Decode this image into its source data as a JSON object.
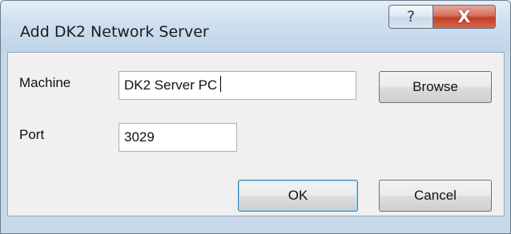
{
  "window": {
    "title": "Add DK2 Network Server"
  },
  "caption_buttons": {
    "help": {
      "icon": "help-icon",
      "glyph": "?"
    },
    "close": {
      "icon": "close-icon",
      "glyph": "X"
    }
  },
  "form": {
    "machine": {
      "label": "Machine",
      "value": "DK2 Server PC"
    },
    "port": {
      "label": "Port",
      "value": "3029"
    }
  },
  "buttons": {
    "browse": "Browse",
    "ok": "OK",
    "cancel": "Cancel"
  },
  "colors": {
    "titlebar": "#c9dbec",
    "close_button": "#c23e24",
    "client_background": "#f0f0f0"
  }
}
